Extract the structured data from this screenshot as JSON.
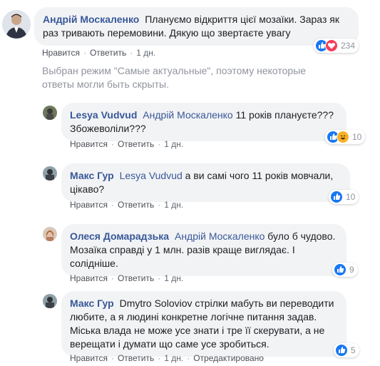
{
  "top_comment": {
    "author": "Андрій Москаленко",
    "text": "Плануємо відкриття цієї мозаїки. Зараз як раз тривають перемовини. Дякую що звертаєте увагу",
    "like_label": "Нравится",
    "reply_label": "Ответить",
    "time": "1 дн.",
    "reactions": [
      "like",
      "love"
    ],
    "reaction_count": "234"
  },
  "notice_text": "Выбран режим \"Самые актуальные\", поэтому некоторые ответы могли быть скрыты.",
  "replies": [
    {
      "author": "Lesya Vudvud",
      "mention": "Андрій Москаленко",
      "text": " 11 років плануєте??? Збожеволіли???",
      "like_label": "Нравится",
      "reply_label": "Ответить",
      "time": "1 дн.",
      "reactions": [
        "like",
        "haha"
      ],
      "reaction_count": "10"
    },
    {
      "author": "Макс Гур",
      "mention": "Lesya Vudvud",
      "text": " а ви самі чого 11 років мовчали, цікаво?",
      "like_label": "Нравится",
      "reply_label": "Ответить",
      "time": "1 дн.",
      "reactions": [
        "like"
      ],
      "reaction_count": "10"
    },
    {
      "author": "Олеся Домарадзька",
      "mention": "Андрій Москаленко",
      "text": " було б чудово. Мозаїка справді у 1 млн. разів краще виглядає. І солідніше.",
      "like_label": "Нравится",
      "reply_label": "Ответить",
      "time": "1 дн.",
      "reactions": [
        "like"
      ],
      "reaction_count": "9"
    },
    {
      "author": "Макс Гур",
      "mention": "",
      "text": "Dmytro Soloviov стрілки мабуть ви переводити любите, а я людині конкретне логічне питання задав. Міська влада не може усе знати і тре її скерувати, а не верещати і думати що саме усе зробиться.",
      "like_label": "Нравится",
      "reply_label": "Ответить",
      "time": "1 дн.",
      "edited_label": "Отредактировано",
      "reactions": [
        "like"
      ],
      "reaction_count": "5"
    }
  ],
  "colors": {
    "link": "#385898",
    "bubble": "#f2f3f5",
    "meta": "#606770",
    "like": "#1877f2"
  }
}
